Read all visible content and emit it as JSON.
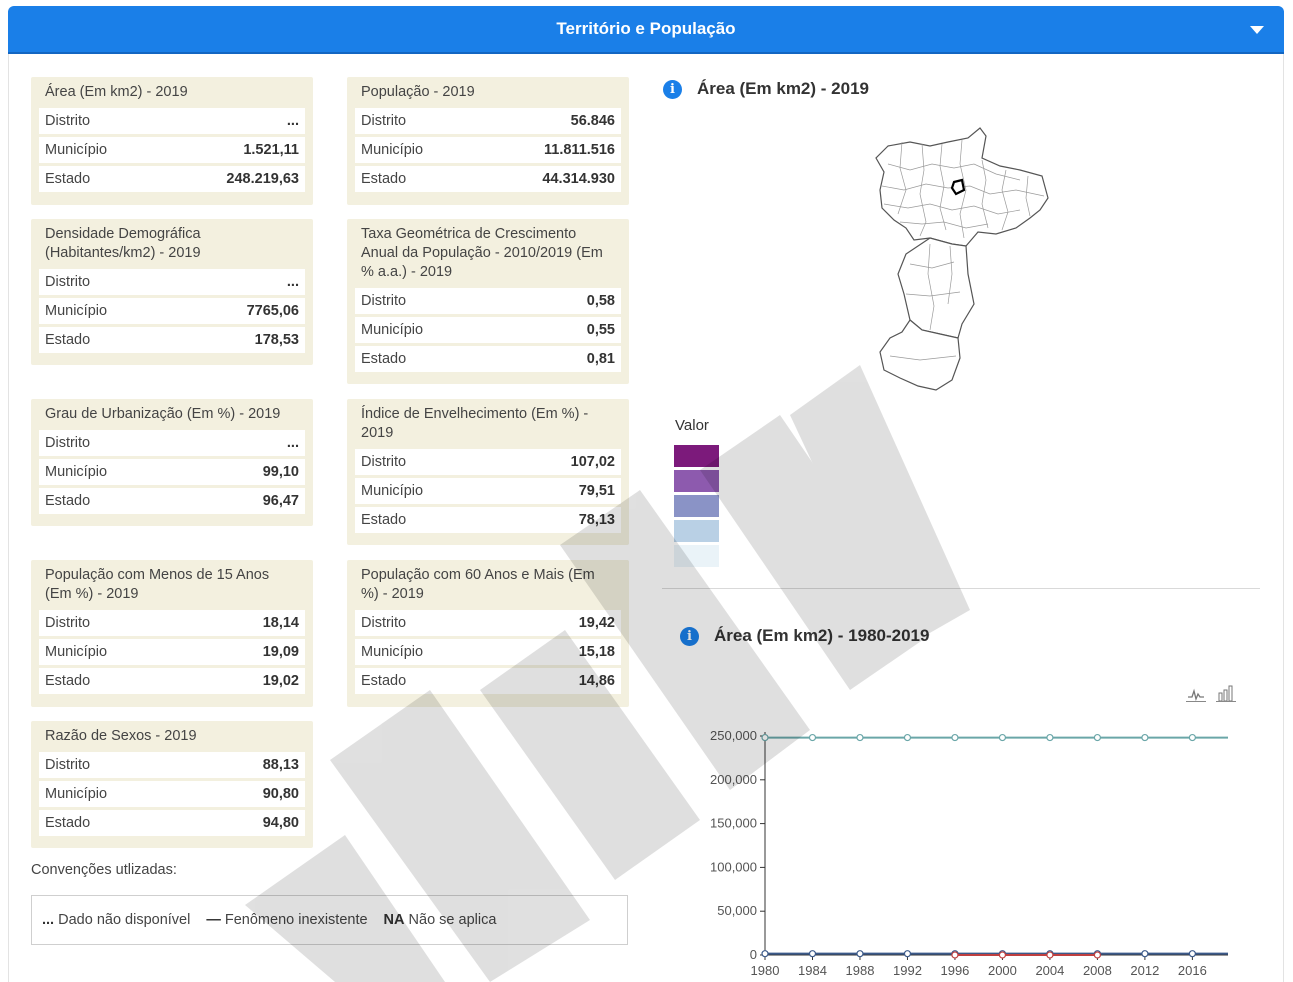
{
  "header": {
    "title": "Território e População"
  },
  "cards": [
    {
      "title": "Área (Em km2) - 2019",
      "rows": [
        {
          "label": "Distrito",
          "value": "..."
        },
        {
          "label": "Município",
          "value": "1.521,11"
        },
        {
          "label": "Estado",
          "value": "248.219,63"
        }
      ]
    },
    {
      "title": "População - 2019",
      "rows": [
        {
          "label": "Distrito",
          "value": "56.846"
        },
        {
          "label": "Município",
          "value": "11.811.516"
        },
        {
          "label": "Estado",
          "value": "44.314.930"
        }
      ]
    },
    {
      "title": "Densidade Demográfica (Habitantes/km2) - 2019",
      "rows": [
        {
          "label": "Distrito",
          "value": "..."
        },
        {
          "label": "Município",
          "value": "7765,06"
        },
        {
          "label": "Estado",
          "value": "178,53"
        }
      ]
    },
    {
      "title": "Taxa Geométrica de Crescimento Anual da População - 2010/2019 (Em % a.a.) - 2019",
      "rows": [
        {
          "label": "Distrito",
          "value": "0,58"
        },
        {
          "label": "Município",
          "value": "0,55"
        },
        {
          "label": "Estado",
          "value": "0,81"
        }
      ]
    },
    {
      "title": "Grau de Urbanização (Em %) - 2019",
      "rows": [
        {
          "label": "Distrito",
          "value": "..."
        },
        {
          "label": "Município",
          "value": "99,10"
        },
        {
          "label": "Estado",
          "value": "96,47"
        }
      ]
    },
    {
      "title": "Índice de Envelhecimento (Em %) - 2019",
      "rows": [
        {
          "label": "Distrito",
          "value": "107,02"
        },
        {
          "label": "Município",
          "value": "79,51"
        },
        {
          "label": "Estado",
          "value": "78,13"
        }
      ]
    },
    {
      "title": "População com Menos de 15 Anos (Em %) - 2019",
      "rows": [
        {
          "label": "Distrito",
          "value": "18,14"
        },
        {
          "label": "Município",
          "value": "19,09"
        },
        {
          "label": "Estado",
          "value": "19,02"
        }
      ]
    },
    {
      "title": "População com 60 Anos e Mais (Em %) - 2019",
      "rows": [
        {
          "label": "Distrito",
          "value": "19,42"
        },
        {
          "label": "Município",
          "value": "15,18"
        },
        {
          "label": "Estado",
          "value": "14,86"
        }
      ]
    },
    {
      "title": "Razão de Sexos - 2019",
      "rows": [
        {
          "label": "Distrito",
          "value": "88,13"
        },
        {
          "label": "Município",
          "value": "90,80"
        },
        {
          "label": "Estado",
          "value": "94,80"
        }
      ]
    }
  ],
  "conventions": {
    "label": "Convenções utlizadas:",
    "items": [
      {
        "symbol": "...",
        "text": "Dado não disponível"
      },
      {
        "symbol": "—",
        "text": "Fenômeno inexistente"
      },
      {
        "symbol": "NA",
        "text": "Não se aplica"
      }
    ]
  },
  "map_section": {
    "title": "Área (Em km2) - 2019",
    "icon": "info-icon",
    "legend_title": "Valor",
    "legend_colors": [
      "#7c1a7b",
      "#8d5aae",
      "#8a93c6",
      "#b9d0e5",
      "#eaf3f8"
    ]
  },
  "chart_section": {
    "title": "Área (Em km2) - 1980-2019",
    "icon": "info-icon",
    "tools": [
      "line-chart-icon",
      "bar-chart-icon"
    ]
  },
  "chart_data": {
    "type": "line",
    "title": "",
    "xlabel": "",
    "ylabel": "",
    "x": [
      1980,
      1984,
      1988,
      1992,
      1996,
      2000,
      2004,
      2008,
      2012,
      2016
    ],
    "xlim": [
      1980,
      2019
    ],
    "ylim": [
      0,
      250000
    ],
    "y_ticks": [
      "0",
      "50,000",
      "100,000",
      "150,000",
      "200,000",
      "250,000"
    ],
    "x_tick_labels": [
      "1980",
      "1984",
      "1988",
      "1992",
      "1996",
      "2000",
      "2004",
      "2008",
      "2012",
      "2016"
    ],
    "series": [
      {
        "values": [
          248209,
          248209,
          248209,
          248209,
          248209,
          248209,
          248209,
          248209,
          248209,
          248209
        ],
        "color": "#6aa6a8"
      },
      {
        "values": [
          1509,
          1509,
          1509,
          1509,
          1509,
          1509,
          1509,
          1509,
          1509,
          1509
        ],
        "color": "#3c5a8a"
      },
      {
        "values": [
          null,
          null,
          null,
          null,
          0,
          0,
          0,
          0,
          null,
          null
        ],
        "color": "#c04040"
      }
    ]
  }
}
